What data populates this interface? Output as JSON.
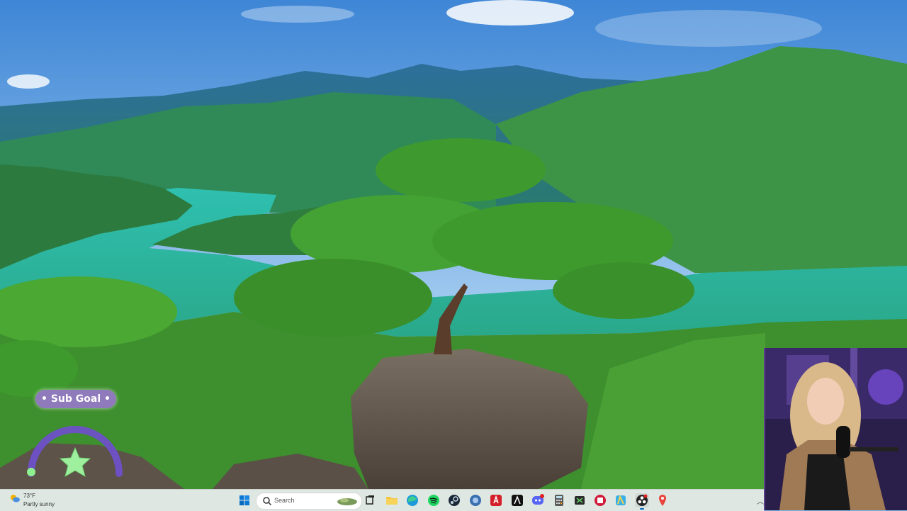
{
  "overlay": {
    "sub_goal_label": "• Sub Goal •"
  },
  "taskbar": {
    "weather": {
      "temperature": "73°F",
      "condition": "Partly sunny"
    },
    "search": {
      "placeholder": "Search"
    },
    "pinned_apps": [
      {
        "name": "start-button",
        "icon": "windows-icon"
      },
      {
        "name": "task-view",
        "icon": "task-view-icon"
      },
      {
        "name": "file-explorer",
        "icon": "folder-icon"
      },
      {
        "name": "edge",
        "icon": "edge-icon"
      },
      {
        "name": "spotify",
        "icon": "spotify-icon"
      },
      {
        "name": "steam",
        "icon": "steam-icon"
      },
      {
        "name": "app",
        "icon": "app-icon"
      },
      {
        "name": "adobe",
        "icon": "adobe-icon"
      },
      {
        "name": "app",
        "icon": "app-icon"
      },
      {
        "name": "discord",
        "icon": "discord-icon"
      },
      {
        "name": "calculator",
        "icon": "calculator-icon"
      },
      {
        "name": "xbox",
        "icon": "xbox-icon"
      },
      {
        "name": "app",
        "icon": "app-icon"
      },
      {
        "name": "app",
        "icon": "app-icon"
      },
      {
        "name": "obs",
        "icon": "obs-icon"
      },
      {
        "name": "maps",
        "icon": "map-pin-icon"
      }
    ]
  },
  "colors": {
    "sky": "#7fb6e8",
    "water": "#2fbfa6",
    "forest": "#3f8f3a",
    "taskbar": "#e2e9e2",
    "sub_goal_pill": "#9678c8",
    "accent": "#0067c0"
  }
}
